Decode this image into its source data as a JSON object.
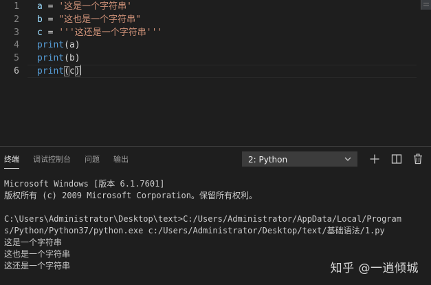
{
  "editor": {
    "line_numbers": [
      "1",
      "2",
      "3",
      "4",
      "5",
      "6"
    ],
    "lines": [
      {
        "var": "a",
        "op": " = ",
        "str": "'这是一个字符串'"
      },
      {
        "var": "b",
        "op": " = ",
        "str": "\"这也是一个字符串\""
      },
      {
        "var": "c",
        "op": " = ",
        "str": "'''这还是一个字符串'''"
      },
      {
        "fn": "print",
        "open": "(",
        "arg": "a",
        "close": ")"
      },
      {
        "fn": "print",
        "open": "(",
        "arg": "b",
        "close": ")"
      },
      {
        "fn": "print",
        "open": "(",
        "arg": "c",
        "close": ")"
      }
    ]
  },
  "panel": {
    "tabs": {
      "terminal": "终端",
      "debug_console": "调试控制台",
      "problems": "问题",
      "output": "输出"
    },
    "terminal_select": "2: Python",
    "actions": {
      "new": "plus-icon",
      "split": "split-icon",
      "kill": "trash-icon"
    }
  },
  "terminal": {
    "lines": [
      "Microsoft Windows [版本 6.1.7601]",
      "版权所有 (c) 2009 Microsoft Corporation。保留所有权利。",
      "",
      "C:\\Users\\Administrator\\Desktop\\text>C:/Users/Administrator/AppData/Local/Program",
      "s/Python/Python37/python.exe c:/Users/Administrator/Desktop/text/基础语法/1.py",
      "这是一个字符串",
      "这也是一个字符串",
      "这还是一个字符串"
    ]
  },
  "watermark": "知乎 @一逍倾城",
  "colors": {
    "editor_bg": "#1e1e1e",
    "string": "#ce9178",
    "variable": "#9cdcfe",
    "keyword_fn": "#569cd6",
    "line_number": "#858585"
  }
}
